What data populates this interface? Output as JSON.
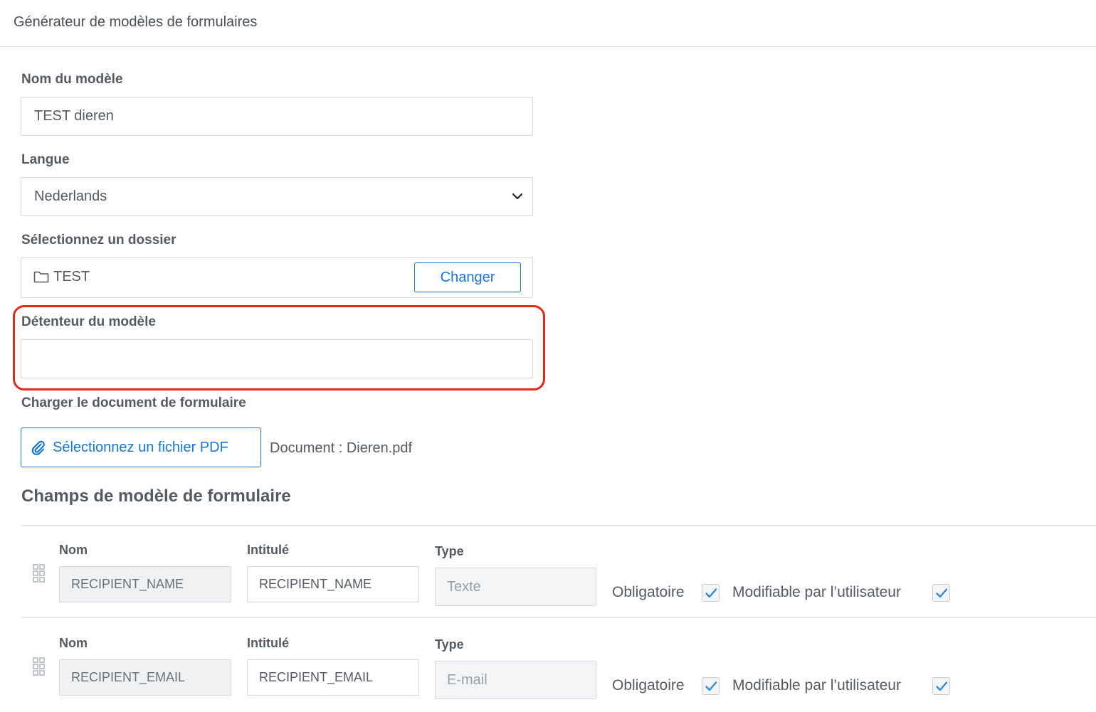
{
  "header": {
    "title": "Générateur de modèles de formulaires"
  },
  "form": {
    "name_label": "Nom du modèle",
    "name_value": "TEST dieren",
    "language_label": "Langue",
    "language_value": "Nederlands",
    "folder_label": "Sélectionnez un dossier",
    "folder_value": "TEST",
    "change_button": "Changer",
    "owner_label": "Détenteur du modèle",
    "owner_value": "",
    "upload_label": "Charger le document de formulaire",
    "pdf_button": "Sélectionnez un fichier PDF",
    "document_text": "Document : Dieren.pdf"
  },
  "fields_section": {
    "title": "Champs de modèle de formulaire",
    "col_name": "Nom",
    "col_label": "Intitulé",
    "col_type": "Type",
    "required_label": "Obligatoire",
    "editable_label": "Modifiable par l’utilisateur",
    "rows": [
      {
        "name": "RECIPIENT_NAME",
        "label": "RECIPIENT_NAME",
        "type": "Texte",
        "required": true,
        "editable": true
      },
      {
        "name": "RECIPIENT_EMAIL",
        "label": "RECIPIENT_EMAIL",
        "type": "E-mail",
        "required": true,
        "editable": true
      }
    ]
  },
  "colors": {
    "accent": "#1677d6",
    "highlight": "#e8271c",
    "check": "#2f8ae5"
  }
}
